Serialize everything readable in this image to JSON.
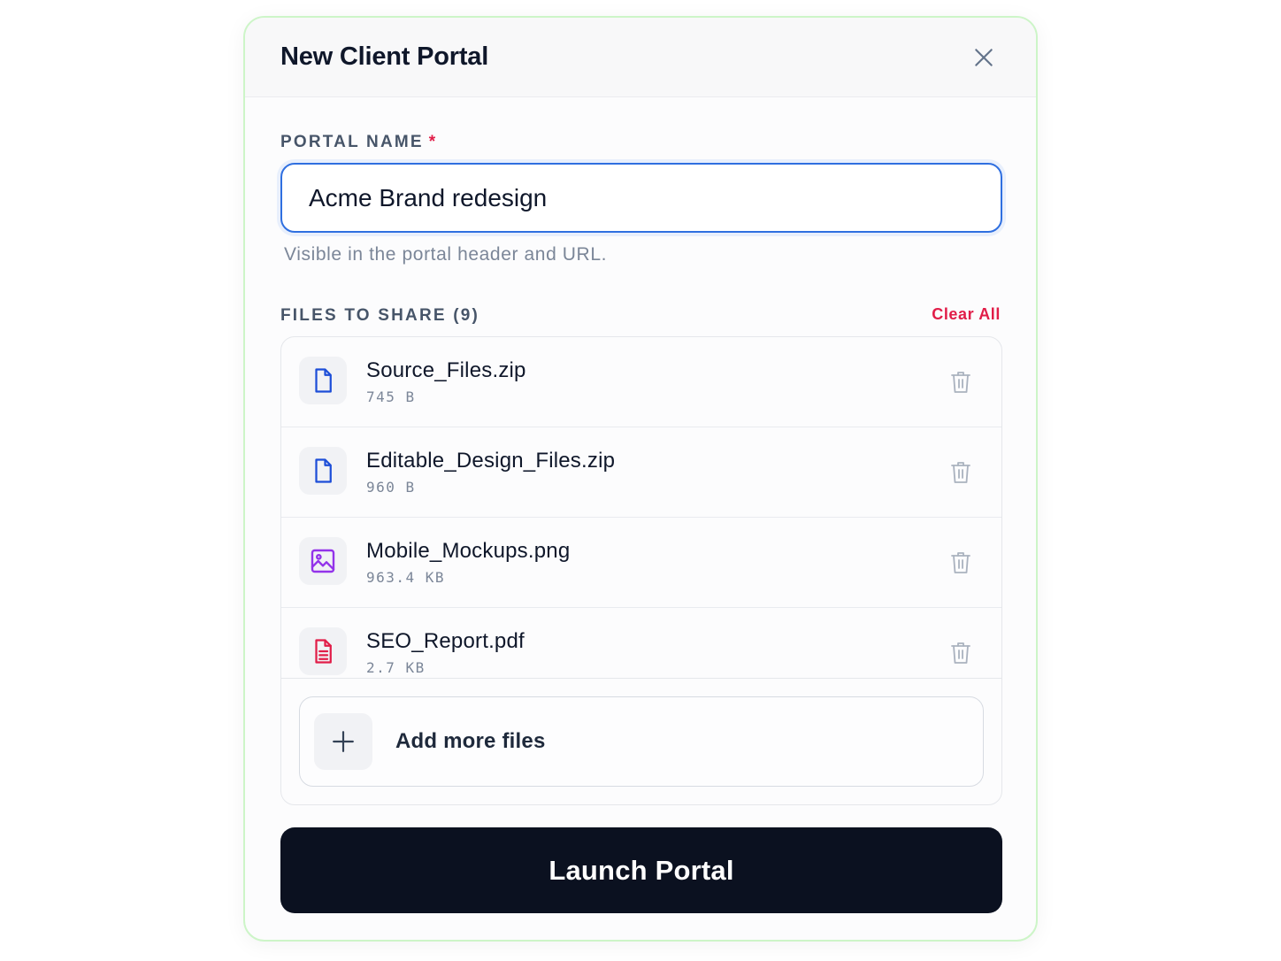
{
  "dialog": {
    "title": "New Client Portal",
    "close_icon": "close-icon",
    "accent_color": "#2f6fe0",
    "danger_color": "#e11d48"
  },
  "portal_name": {
    "label": "PORTAL NAME",
    "required_marker": "*",
    "value": "Acme Brand redesign",
    "helper": "Visible in the portal header and URL."
  },
  "files": {
    "label": "FILES TO SHARE (9)",
    "clear_all_label": "Clear All",
    "items": [
      {
        "name": "Source_Files.zip",
        "size": "745 B",
        "icon": "file-icon",
        "icon_color": "#1d4ed8"
      },
      {
        "name": "Editable_Design_Files.zip",
        "size": "960 B",
        "icon": "file-icon",
        "icon_color": "#1d4ed8"
      },
      {
        "name": "Mobile_Mockups.png",
        "size": "963.4 KB",
        "icon": "image-icon",
        "icon_color": "#9333ea"
      },
      {
        "name": "SEO_Report.pdf",
        "size": "2.7 KB",
        "icon": "document-text-icon",
        "icon_color": "#e11d48"
      }
    ],
    "delete_icon": "trash-icon",
    "add_more_label": "Add more files",
    "add_icon": "plus-icon"
  },
  "actions": {
    "launch_label": "Launch Portal"
  }
}
